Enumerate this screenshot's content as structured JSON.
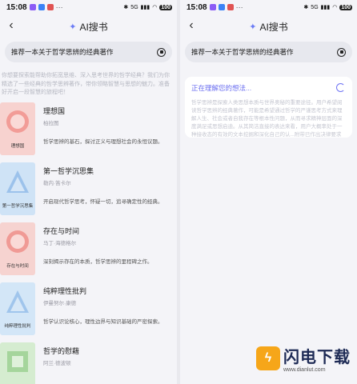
{
  "left": {
    "status": {
      "time": "15:08",
      "signal_text": "5G",
      "battery": "100"
    },
    "header": {
      "title": "AI搜书",
      "back_icon": "chevron-left-icon"
    },
    "search": {
      "query": "推荐一本关于哲学思辨的经典著作"
    },
    "intro": "你想要探索能帮助你拓宽思维、深入思考世界的哲学经典？我们为你精选了一些经典的哲学思辨著作，带你领略智慧与思想的魅力。准备好开启一段智慧的旅程吧！",
    "books": [
      {
        "title": "理想国",
        "author": "柏拉图",
        "desc": "哲学思辨的基石，探讨正义与理想社会的永恒议题。",
        "cover_text": "理想国",
        "cover_color": "#f7d2cf",
        "deco_color": "#f08f88"
      },
      {
        "title": "第一哲学沉思集",
        "author": "勒内·笛卡尔",
        "desc": "开启现代哲学思考，怀疑一切，追寻确定性的经典。",
        "cover_text": "第一哲学沉思集",
        "cover_color": "#cfe3f6",
        "deco_color": "#8fb9e8"
      },
      {
        "title": "存在与时间",
        "author": "马丁·海德格尔",
        "desc": "深刻揭示存在的本质，哲学思辨的里程碑之作。",
        "cover_text": "存在与时间",
        "cover_color": "#f6d3d0",
        "deco_color": "#ef8c86"
      },
      {
        "title": "纯粹理性批判",
        "author": "伊曼努尔·康德",
        "desc": "哲学认识论核心，理性边界与知识基础的严密探索。",
        "cover_text": "纯粹理性批判",
        "cover_color": "#d3e6f7",
        "deco_color": "#93bde8"
      },
      {
        "title": "哲学的慰藉",
        "author": "阿兰·德波顿",
        "desc": "",
        "cover_text": "",
        "cover_color": "#d5ecd0",
        "deco_color": "#99d08f"
      }
    ]
  },
  "right": {
    "status": {
      "time": "15:08",
      "signal_text": "5G",
      "battery": "100"
    },
    "header": {
      "title": "AI搜书"
    },
    "search": {
      "query": "推荐一本关于哲学思辨的经典著作"
    },
    "thinking": {
      "label": "正在理解您的想法...",
      "body": "哲学思辨是探索人类思想本质与世界奥秘的重要途径。用户希望阅读哲学思辨的经典著作，可能是希望通过哲学的严谨思考方式来理解人生、社会或者自我存在等根本性问题，从而寻求精神层面的深度满足或思想启迪。从其简洁直接的表达来看，用户大概率处于一种接收态的有效的文本挖掘和深化自己的认...附带已作出决律要求"
    }
  },
  "watermark": {
    "name": "闪电下载",
    "url": "www.dianlut.com"
  }
}
